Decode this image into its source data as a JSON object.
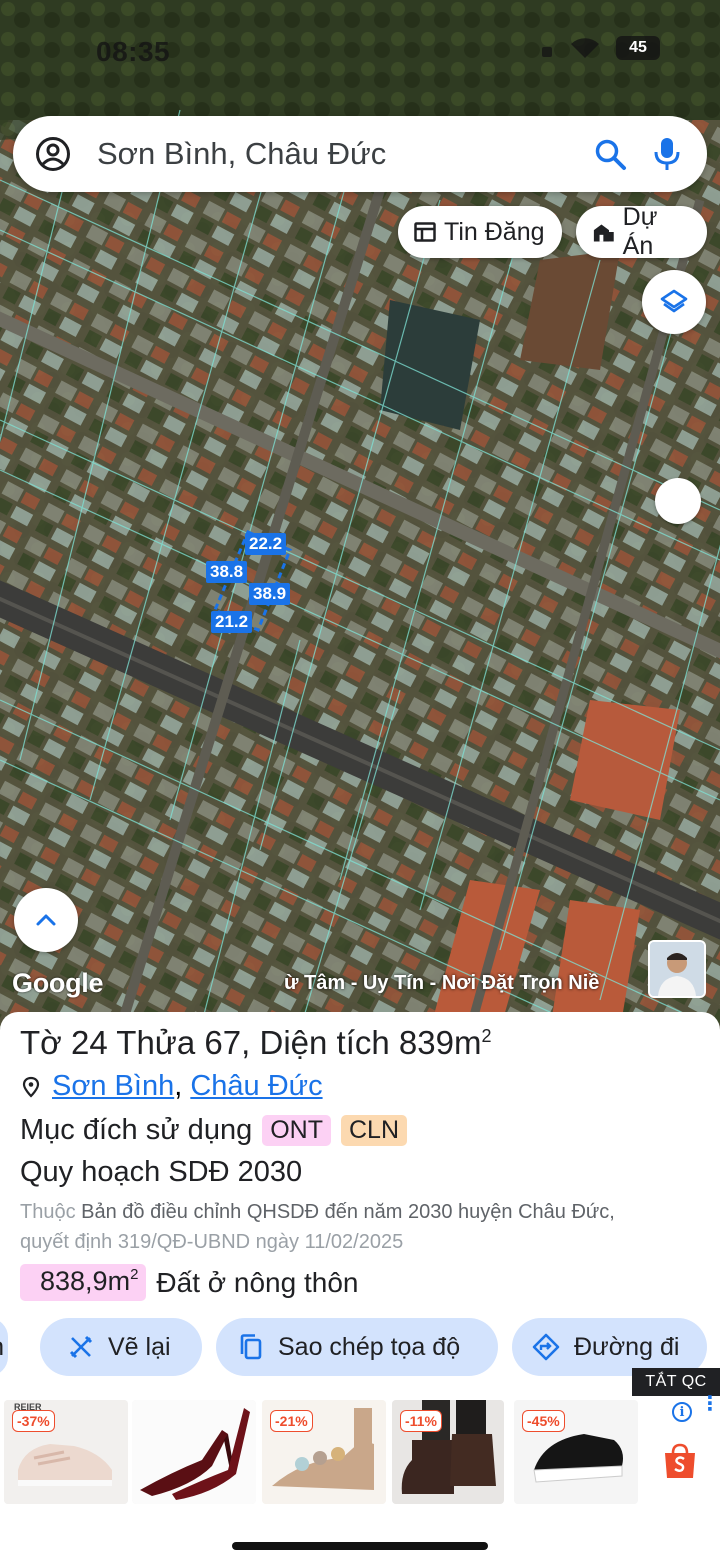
{
  "status": {
    "time": "08:35",
    "battery": "45"
  },
  "search": {
    "text": "Sơn Bình, Châu Đức"
  },
  "chips": {
    "tin_dang": "Tin Đăng",
    "du_an": "Dự Án"
  },
  "plot_dims": [
    "22.2",
    "38.8",
    "38.9",
    "21.2"
  ],
  "map": {
    "google": "Google",
    "banner": "ừ Tâm - Uy Tín - Nơi Đặt Trọn Niề"
  },
  "parcel": {
    "to_label": "Tờ",
    "to_value": "24",
    "thua_label": "Thửa",
    "thua_value": "67",
    "dien_tich_label": "Diện tích",
    "dien_tich_value": "839m",
    "dien_tich_unit_sup": "2",
    "location_commune": "Sơn Bình",
    "location_district": "Châu Đức",
    "purpose_label": "Mục đích sử dụng",
    "purpose_tags": [
      "ONT",
      "CLN"
    ],
    "plan_label": "Quy hoạch SDĐ 2030",
    "source_prefix": "Thuộc",
    "source_text": "Bản đồ điều chỉnh QHSDĐ đến năm 2030 huyện Châu Đức,",
    "source_decision": "quyết định 319/QĐ-UBND ngày 11/02/2025",
    "area_value": "838,9m",
    "area_sup": "2",
    "area_type": "Đất ở nông thôn"
  },
  "actions": {
    "cut_label": "n",
    "ve_lai": "Vẽ lại",
    "sao_chep": "Sao chép tọa độ",
    "duong_di": "Đường đi"
  },
  "ads": {
    "label": "TẮT QC",
    "discounts": [
      "-37%",
      "-21%",
      "-11%",
      "-45%"
    ],
    "brand_text": "REIER"
  },
  "colors": {
    "accent": "#1a73e8",
    "chip_bg": "#d3e3fd",
    "tag_pink": "#fcd1f4",
    "tag_orange": "#fcd9b0"
  }
}
